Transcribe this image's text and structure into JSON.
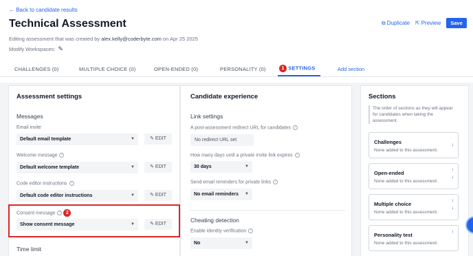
{
  "header": {
    "back_link": "← Back to candidate results",
    "title": "Technical Assessment",
    "subtitle_prefix": "Editing assessment that was created by",
    "subtitle_email": "alex.kelly@coderbyte.com",
    "subtitle_suffix": "on Apr 25 2025",
    "modify_workspaces": "Modify Workspaces:",
    "duplicate": "Duplicate",
    "preview": "Preview",
    "save": "Save"
  },
  "tabs": [
    {
      "label": "CHALLENGES (0)"
    },
    {
      "label": "MULTIPLE CHOICE (0)"
    },
    {
      "label": "OPEN-ENDED (0)"
    },
    {
      "label": "PERSONALITY (0)"
    },
    {
      "label": "SETTINGS",
      "badge": "1"
    },
    {
      "label": "Add section"
    }
  ],
  "assessment_settings": {
    "heading": "Assessment settings",
    "messages_heading": "Messages",
    "email_invite": {
      "label": "Email invite",
      "value": "Default email template"
    },
    "welcome_message": {
      "label": "Welcome message",
      "value": "Default welcome template"
    },
    "code_editor": {
      "label": "Code editor instructions",
      "value": "Default code editor instructions"
    },
    "consent_message": {
      "label": "Consent message",
      "value": "Show consent message",
      "badge": "2"
    },
    "edit_label": "EDIT",
    "time_limit_heading": "Time limit"
  },
  "candidate_experience": {
    "heading": "Candidate experience",
    "link_settings_heading": "Link settings",
    "redirect": {
      "label": "A post-assessment redirect URL for candidates",
      "value": "No redirect URL set"
    },
    "expiry": {
      "label": "How many days until a private invite link expires",
      "value": "30 days"
    },
    "reminders": {
      "label": "Send email reminders for private links",
      "value": "No email reminders"
    },
    "cheating_heading": "Cheating detection",
    "identity": {
      "label": "Enable identity verification",
      "value": "No"
    }
  },
  "sections": {
    "heading": "Sections",
    "description": "The order of sections as they will appear for candidates when taking the assessment.",
    "items": [
      {
        "title": "Challenges",
        "desc": "None added to this assessment."
      },
      {
        "title": "Open-ended",
        "desc": "None added to this assessment."
      },
      {
        "title": "Multiple choice",
        "desc": "None added to this assessment."
      },
      {
        "title": "Personality test",
        "desc": "None added to this assessment."
      }
    ]
  },
  "colors": {
    "accent": "#2563eb",
    "highlight": "#dc2626"
  }
}
